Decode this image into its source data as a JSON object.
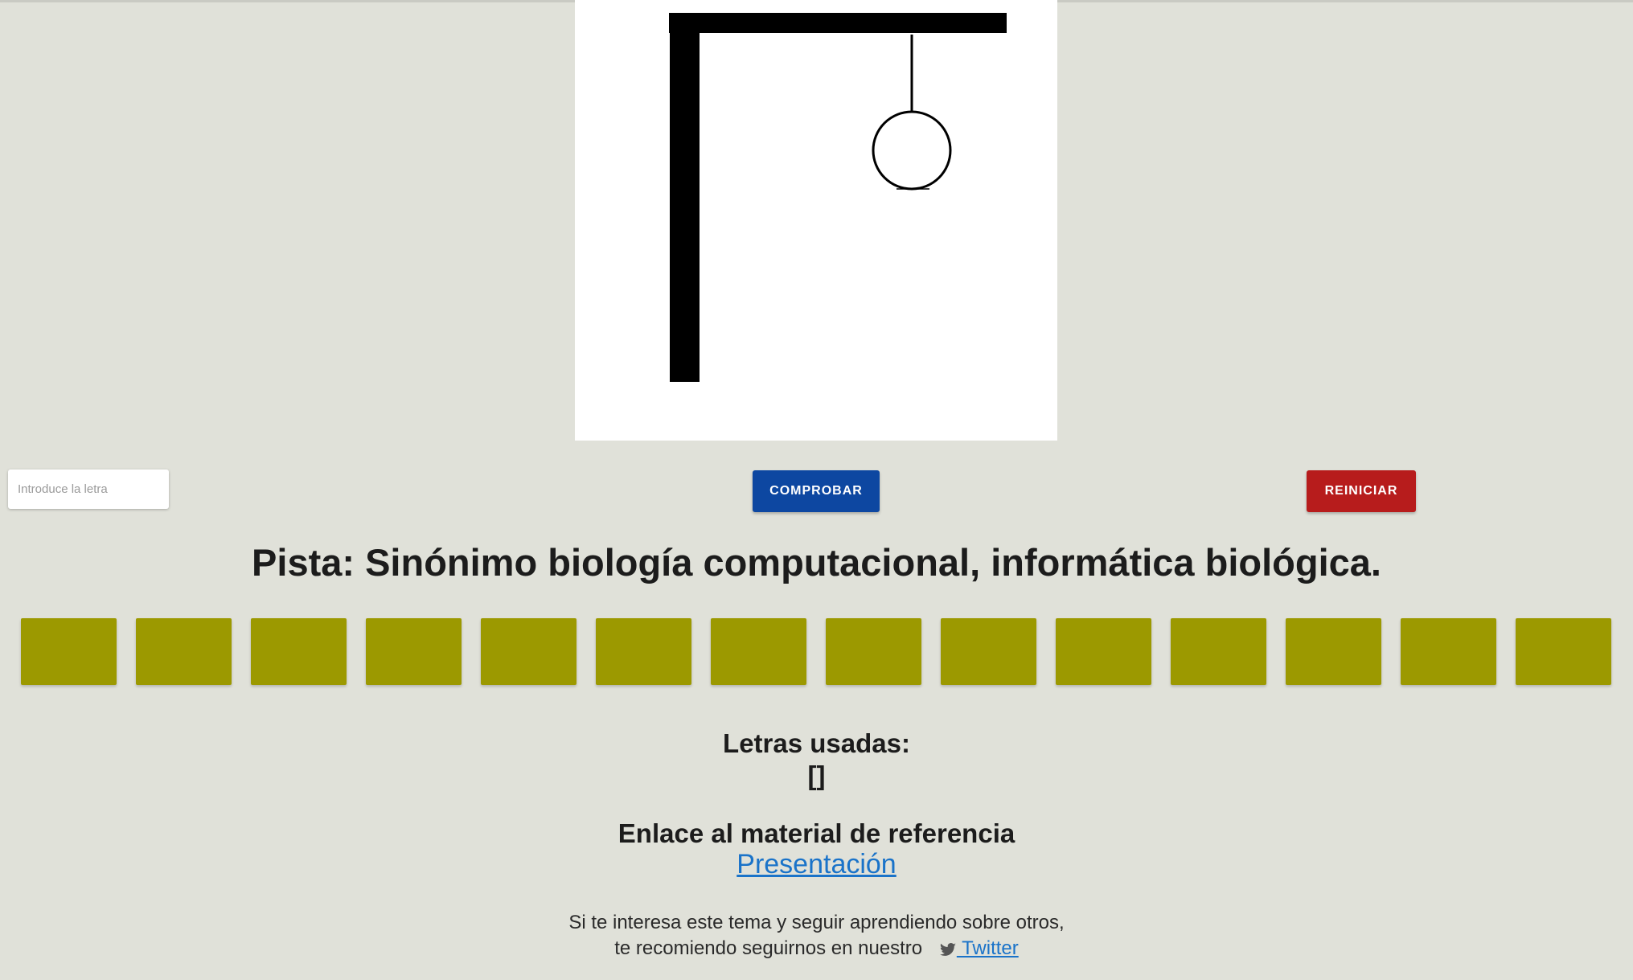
{
  "input": {
    "placeholder": "Introduce la letra",
    "value": ""
  },
  "buttons": {
    "check_label": "COMPROBAR",
    "reset_label": "REINICIAR",
    "check_color": "#0d47a1",
    "reset_color": "#b71c1c"
  },
  "hint": "Pista: Sinónimo biología computacional, informática biológica.",
  "word": {
    "tile_color": "#9c9900",
    "letters": [
      "",
      "",
      "",
      "",
      "",
      "",
      "",
      "",
      "",
      "",
      "",
      "",
      "",
      ""
    ]
  },
  "used": {
    "title": "Letras usadas:",
    "value": "[]"
  },
  "reference": {
    "title": "Enlace al material de referencia",
    "link": "Presentación"
  },
  "footer": {
    "line1": "Si te interesa este tema y seguir aprendiendo sobre otros,",
    "line2": "te recomiendo seguirnos en nuestro",
    "twitter_label": " Twitter",
    "twitter_icon": "twitter-icon"
  },
  "hangman": {
    "errors": 1,
    "parts": [
      "gallows",
      "rope",
      "head"
    ]
  }
}
